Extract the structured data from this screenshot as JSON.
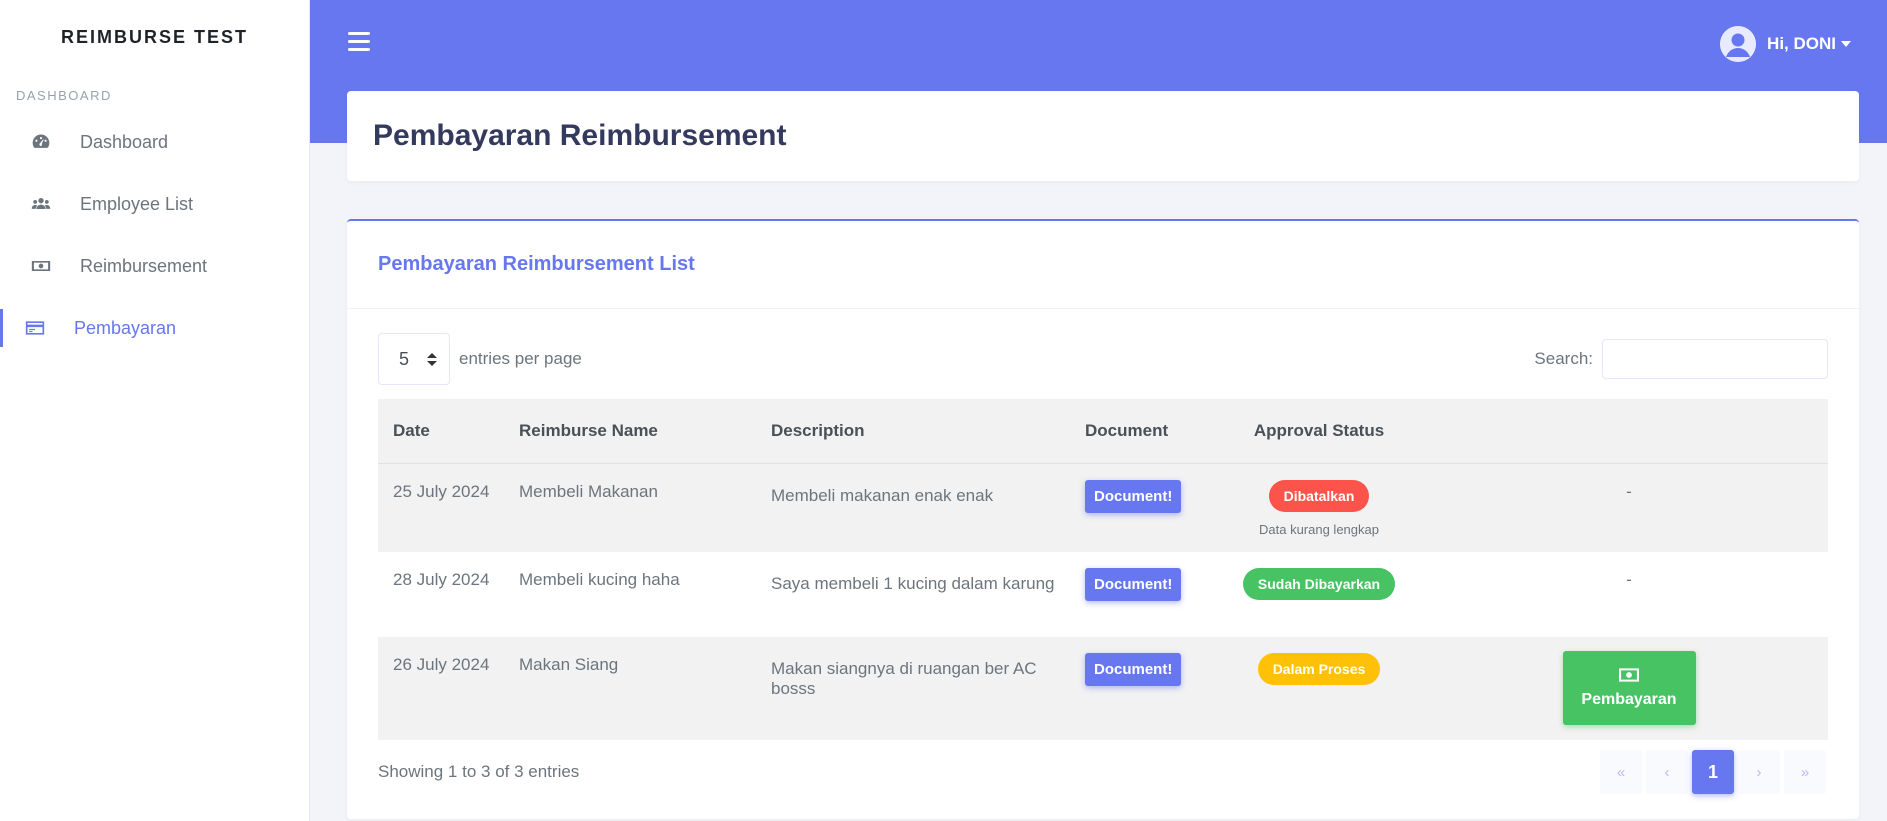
{
  "app": {
    "brand": "REIMBURSE TEST"
  },
  "sidebar": {
    "section_label": "DASHBOARD",
    "items": [
      {
        "label": "Dashboard",
        "icon": "tachometer-icon",
        "active": false
      },
      {
        "label": "Employee List",
        "icon": "users-icon",
        "active": false
      },
      {
        "label": "Reimbursement",
        "icon": "money-bill-icon",
        "active": false
      },
      {
        "label": "Pembayaran",
        "icon": "credit-card-icon",
        "active": true
      }
    ]
  },
  "header": {
    "greeting": "Hi, DONI"
  },
  "page": {
    "title": "Pembayaran Reimbursement"
  },
  "list": {
    "title": "Pembayaran Reimbursement List",
    "entries_value": "5",
    "entries_label": "entries per page",
    "search_label": "Search:",
    "search_value": "",
    "columns": [
      "Date",
      "Reimburse Name",
      "Description",
      "Document",
      "Approval Status",
      ""
    ],
    "rows": [
      {
        "date": "25 July 2024",
        "name": "Membeli Makanan",
        "description": "Membeli makanan enak enak",
        "document": "Document!",
        "status": "Dibatalkan",
        "status_color": "#fc544b",
        "note": "Data kurang lengkap",
        "action": "-"
      },
      {
        "date": "28 July 2024",
        "name": "Membeli kucing haha",
        "description": "Saya membeli 1 kucing dalam karung",
        "document": "Document!",
        "status": "Sudah Dibayarkan",
        "status_color": "#47c363",
        "note": "",
        "action": "-"
      },
      {
        "date": "26 July 2024",
        "name": "Makan Siang",
        "description": "Makan siangnya di ruangan ber AC bosss",
        "document": "Document!",
        "status": "Dalam Proses",
        "status_color": "#ffc107",
        "note": "",
        "action": "Pembayaran"
      }
    ],
    "info": "Showing 1 to 3 of 3 entries",
    "pagination": {
      "first": "«",
      "prev": "‹",
      "current": "1",
      "next": "›",
      "last": "»"
    }
  },
  "colors": {
    "primary": "#6777ef",
    "success": "#47c363",
    "danger": "#fc544b",
    "warning": "#ffc107"
  }
}
